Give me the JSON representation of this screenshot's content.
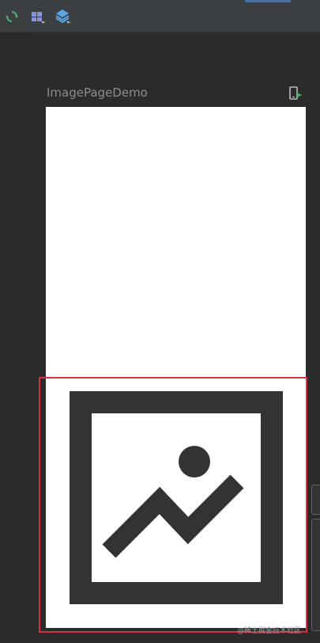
{
  "toolbar": {
    "icons": [
      "refresh-icon",
      "layout-grid-icon",
      "layers-icon"
    ]
  },
  "preview": {
    "title": "ImagePageDemo",
    "device_icon": "device-preview-icon"
  },
  "component": {
    "type_icon": "image-placeholder-icon",
    "selected": true
  },
  "colors": {
    "selection": "#d23240",
    "screen": "#ffffff",
    "toolbar_bg": "#3c3f41",
    "canvas_bg": "#2b2b2b"
  },
  "watermark": "@稀土掘金技术社区"
}
